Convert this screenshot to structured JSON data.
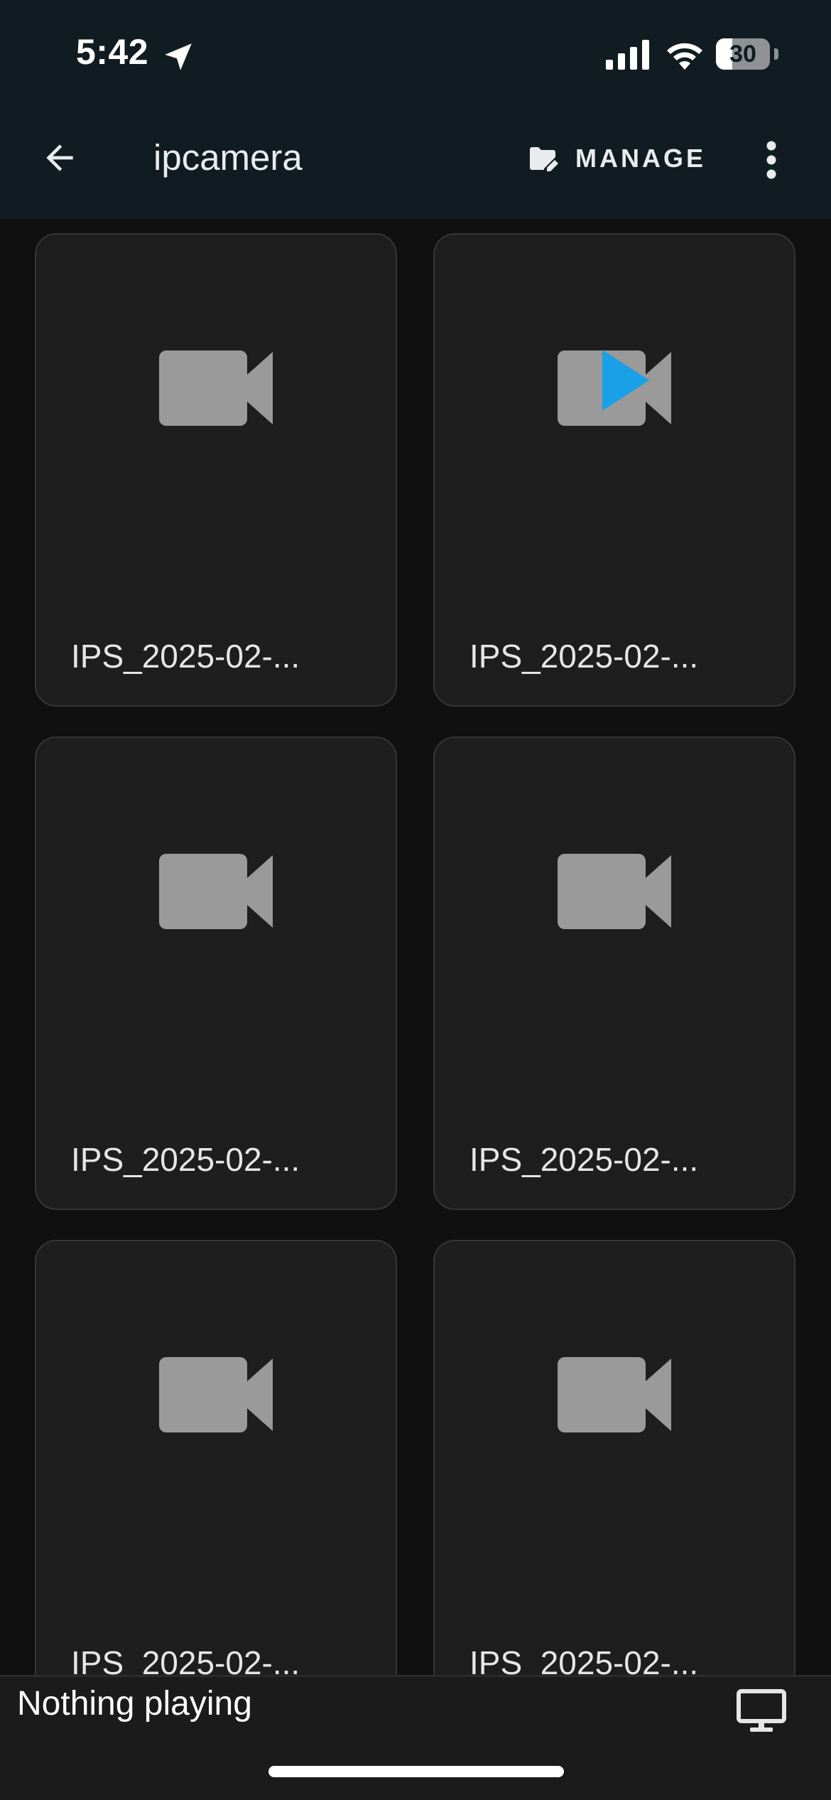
{
  "status_bar": {
    "time": "5:42",
    "battery_level": "30",
    "battery_fraction": 0.3
  },
  "app_bar": {
    "title": "ipcamera",
    "manage_label": "MANAGE"
  },
  "files": [
    {
      "name": "IPS_2025-02-...",
      "icon": "video-camera-icon",
      "now_playing": false
    },
    {
      "name": "IPS_2025-02-...",
      "icon": "video-camera-icon",
      "now_playing": true
    },
    {
      "name": "IPS_2025-02-...",
      "icon": "video-camera-icon",
      "now_playing": false
    },
    {
      "name": "IPS_2025-02-...",
      "icon": "video-camera-icon",
      "now_playing": false
    },
    {
      "name": "IPS_2025-02-...",
      "icon": "video-camera-icon",
      "now_playing": false
    },
    {
      "name": "IPS_2025-02-...",
      "icon": "video-camera-icon",
      "now_playing": false
    }
  ],
  "mini_player": {
    "status": "Nothing playing"
  },
  "colors": {
    "app_bar_bg": "#111c22",
    "card_bg": "#1e1e1e",
    "accent": "#1aa0e6",
    "icon_gray": "#9a9a9a"
  }
}
